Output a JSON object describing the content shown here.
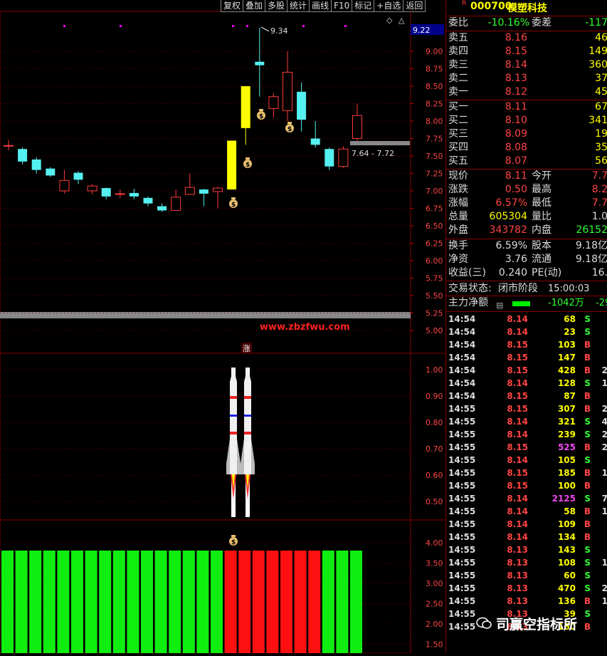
{
  "toolbar": [
    "复权",
    "叠加",
    "多股",
    "统计",
    "画线",
    "F10",
    "标记",
    "+自选",
    "返回"
  ],
  "main_axis": [
    "9.22",
    "9.00",
    "8.75",
    "8.50",
    "8.25",
    "8.00",
    "7.75",
    "7.50",
    "7.25",
    "7.00",
    "6.75",
    "6.50",
    "6.25",
    "6.00",
    "5.75",
    "5.50",
    "5.25",
    "5.00"
  ],
  "annotations": {
    "high": "9.34",
    "range": "7.64 - 7.72",
    "site": "www.zbzfwu.com",
    "zhang": "涨"
  },
  "sub1_axis": [
    "1.00",
    "0.90",
    "0.80",
    "0.70",
    "0.60",
    "0.50"
  ],
  "sub2_axis": [
    "4.00",
    "3.50",
    "3.00",
    "2.50",
    "2.00",
    "1.50"
  ],
  "candles": [
    {
      "o": 7.65,
      "c": 7.65,
      "h": 7.73,
      "l": 7.58
    },
    {
      "o": 7.6,
      "c": 7.42,
      "h": 7.62,
      "l": 7.38
    },
    {
      "o": 7.45,
      "c": 7.3,
      "h": 7.48,
      "l": 7.25
    },
    {
      "o": 7.32,
      "c": 7.22,
      "h": 7.34,
      "l": 7.2
    },
    {
      "o": 7.0,
      "c": 7.15,
      "h": 7.3,
      "l": 6.96
    },
    {
      "o": 7.26,
      "c": 7.16,
      "h": 7.28,
      "l": 7.1
    },
    {
      "o": 7.0,
      "c": 7.07,
      "h": 7.1,
      "l": 6.95
    },
    {
      "o": 7.04,
      "c": 6.92,
      "h": 7.05,
      "l": 6.88
    },
    {
      "o": 6.96,
      "c": 6.96,
      "h": 7.02,
      "l": 6.9
    },
    {
      "o": 6.97,
      "c": 6.92,
      "h": 7.03,
      "l": 6.88
    },
    {
      "o": 6.9,
      "c": 6.82,
      "h": 6.92,
      "l": 6.78
    },
    {
      "o": 6.78,
      "c": 6.72,
      "h": 6.82,
      "l": 6.7
    },
    {
      "o": 6.72,
      "c": 6.91,
      "h": 7.02,
      "l": 6.72
    },
    {
      "o": 6.95,
      "c": 7.05,
      "h": 7.25,
      "l": 6.95
    },
    {
      "o": 7.02,
      "c": 6.96,
      "h": 7.03,
      "l": 6.78
    },
    {
      "o": 6.99,
      "c": 7.04,
      "h": 7.06,
      "l": 6.75
    },
    {
      "o": 7.02,
      "c": 7.72,
      "h": 7.72,
      "l": 7.02
    },
    {
      "o": 7.9,
      "c": 8.5,
      "h": 8.5,
      "l": 7.66
    },
    {
      "o": 8.85,
      "c": 8.8,
      "h": 9.34,
      "l": 8.35
    },
    {
      "o": 8.18,
      "c": 8.35,
      "h": 8.4,
      "l": 8.05
    },
    {
      "o": 8.15,
      "c": 8.7,
      "h": 9.0,
      "l": 8.0
    },
    {
      "o": 8.42,
      "c": 8.02,
      "h": 8.55,
      "l": 7.85
    },
    {
      "o": 7.75,
      "c": 7.66,
      "h": 8.0,
      "l": 7.62
    },
    {
      "o": 7.6,
      "c": 7.35,
      "h": 7.62,
      "l": 7.3
    },
    {
      "o": 7.35,
      "c": 7.6,
      "h": 7.64,
      "l": 7.33
    },
    {
      "o": 7.75,
      "c": 8.08,
      "h": 8.25,
      "l": 7.72
    }
  ],
  "sub2_bars": [
    "green",
    "green",
    "green",
    "green",
    "green",
    "green",
    "green",
    "green",
    "green",
    "green",
    "green",
    "green",
    "green",
    "green",
    "green",
    "green",
    "red",
    "red",
    "red",
    "red",
    "red",
    "red",
    "red",
    "green",
    "green",
    "green"
  ],
  "quote": {
    "badge": "R",
    "code": "000700",
    "name": "模塑科技",
    "weibi_label": "委比",
    "weibi": "-10.16%",
    "weicha_label": "委差",
    "weicha": "-117",
    "sells": [
      {
        "l": "卖五",
        "p": "8.16",
        "v": "46"
      },
      {
        "l": "卖四",
        "p": "8.15",
        "v": "149"
      },
      {
        "l": "卖三",
        "p": "8.14",
        "v": "360"
      },
      {
        "l": "卖二",
        "p": "8.13",
        "v": "37"
      },
      {
        "l": "卖一",
        "p": "8.12",
        "v": "45"
      }
    ],
    "buys": [
      {
        "l": "买一",
        "p": "8.11",
        "v": "67"
      },
      {
        "l": "买二",
        "p": "8.10",
        "v": "341"
      },
      {
        "l": "买三",
        "p": "8.09",
        "v": "19"
      },
      {
        "l": "买四",
        "p": "8.08",
        "v": "35"
      },
      {
        "l": "买五",
        "p": "8.07",
        "v": "56"
      }
    ],
    "stats": [
      {
        "l1": "现价",
        "v1": "8.11",
        "c1": "red",
        "l2": "今开",
        "v2": "7.7",
        "c2": "red"
      },
      {
        "l1": "涨跌",
        "v1": "0.50",
        "c1": "red",
        "l2": "最高",
        "v2": "8.2",
        "c2": "red"
      },
      {
        "l1": "涨幅",
        "v1": "6.57%",
        "c1": "red",
        "l2": "最低",
        "v2": "7.7",
        "c2": "red"
      },
      {
        "l1": "总量",
        "v1": "605304",
        "c1": "yellow",
        "l2": "量比",
        "v2": "1.0",
        "c2": "white"
      },
      {
        "l1": "外盘",
        "v1": "343782",
        "c1": "red",
        "l2": "内盘",
        "v2": "26152",
        "c2": "green"
      }
    ],
    "fund": [
      {
        "l1": "换手",
        "v1": "6.59%",
        "l2": "股本",
        "v2": "9.18亿"
      },
      {
        "l1": "净资",
        "v1": "3.76",
        "l2": "流通",
        "v2": "9.18亿"
      },
      {
        "l1": "收益(三)",
        "v1": "0.240",
        "l2": "PE(动)",
        "v2": "16."
      }
    ],
    "trade_state_label": "交易状态:",
    "trade_state": "闭市阶段",
    "trade_time": "15:00:03",
    "main_net_label": "主力净额",
    "main_net": "-1042万",
    "main_net2": "-29"
  },
  "ticks": [
    {
      "t": "14:54",
      "p": "8.14",
      "v": "68",
      "s": "S",
      "e": ""
    },
    {
      "t": "14:54",
      "p": "8.14",
      "v": "23",
      "s": "S",
      "e": ""
    },
    {
      "t": "14:54",
      "p": "8.15",
      "v": "103",
      "s": "B",
      "e": ""
    },
    {
      "t": "14:54",
      "p": "8.15",
      "v": "147",
      "s": "B",
      "e": ""
    },
    {
      "t": "14:54",
      "p": "8.15",
      "v": "428",
      "s": "B",
      "e": "2"
    },
    {
      "t": "14:54",
      "p": "8.14",
      "v": "128",
      "s": "S",
      "e": "1"
    },
    {
      "t": "14:54",
      "p": "8.15",
      "v": "87",
      "s": "B",
      "e": ""
    },
    {
      "t": "14:55",
      "p": "8.15",
      "v": "307",
      "s": "B",
      "e": "2"
    },
    {
      "t": "14:55",
      "p": "8.14",
      "v": "321",
      "s": "S",
      "e": "4"
    },
    {
      "t": "14:55",
      "p": "8.14",
      "v": "239",
      "s": "S",
      "e": "2"
    },
    {
      "t": "14:55",
      "p": "8.15",
      "v": "525",
      "s": "B",
      "e": "2"
    },
    {
      "t": "14:55",
      "p": "8.14",
      "v": "105",
      "s": "S",
      "e": ""
    },
    {
      "t": "14:55",
      "p": "8.15",
      "v": "185",
      "s": "B",
      "e": "1"
    },
    {
      "t": "14:55",
      "p": "8.15",
      "v": "100",
      "s": "B",
      "e": ""
    },
    {
      "t": "14:55",
      "p": "8.14",
      "v": "2125",
      "s": "S",
      "e": "7"
    },
    {
      "t": "14:55",
      "p": "8.14",
      "v": "58",
      "s": "B",
      "e": "1"
    },
    {
      "t": "14:55",
      "p": "8.14",
      "v": "109",
      "s": "B",
      "e": ""
    },
    {
      "t": "14:55",
      "p": "8.14",
      "v": "134",
      "s": "B",
      "e": ""
    },
    {
      "t": "14:55",
      "p": "8.13",
      "v": "143",
      "s": "S",
      "e": ""
    },
    {
      "t": "14:55",
      "p": "8.13",
      "v": "108",
      "s": "S",
      "e": "1"
    },
    {
      "t": "14:55",
      "p": "8.13",
      "v": "60",
      "s": "S",
      "e": ""
    },
    {
      "t": "14:55",
      "p": "8.13",
      "v": "470",
      "s": "S",
      "e": "2"
    },
    {
      "t": "14:55",
      "p": "8.13",
      "v": "136",
      "s": "B",
      "e": "1"
    },
    {
      "t": "14:55",
      "p": "8.13",
      "v": "39",
      "s": "S",
      "e": ""
    },
    {
      "t": "14:55",
      "p": "8.13",
      "v": "160",
      "s": "B",
      "e": ""
    }
  ],
  "watermark": "司赢空指标所",
  "colors": {
    "up": "#ff3b3b",
    "down": "#55f0f0",
    "panel_red": "#800000"
  }
}
